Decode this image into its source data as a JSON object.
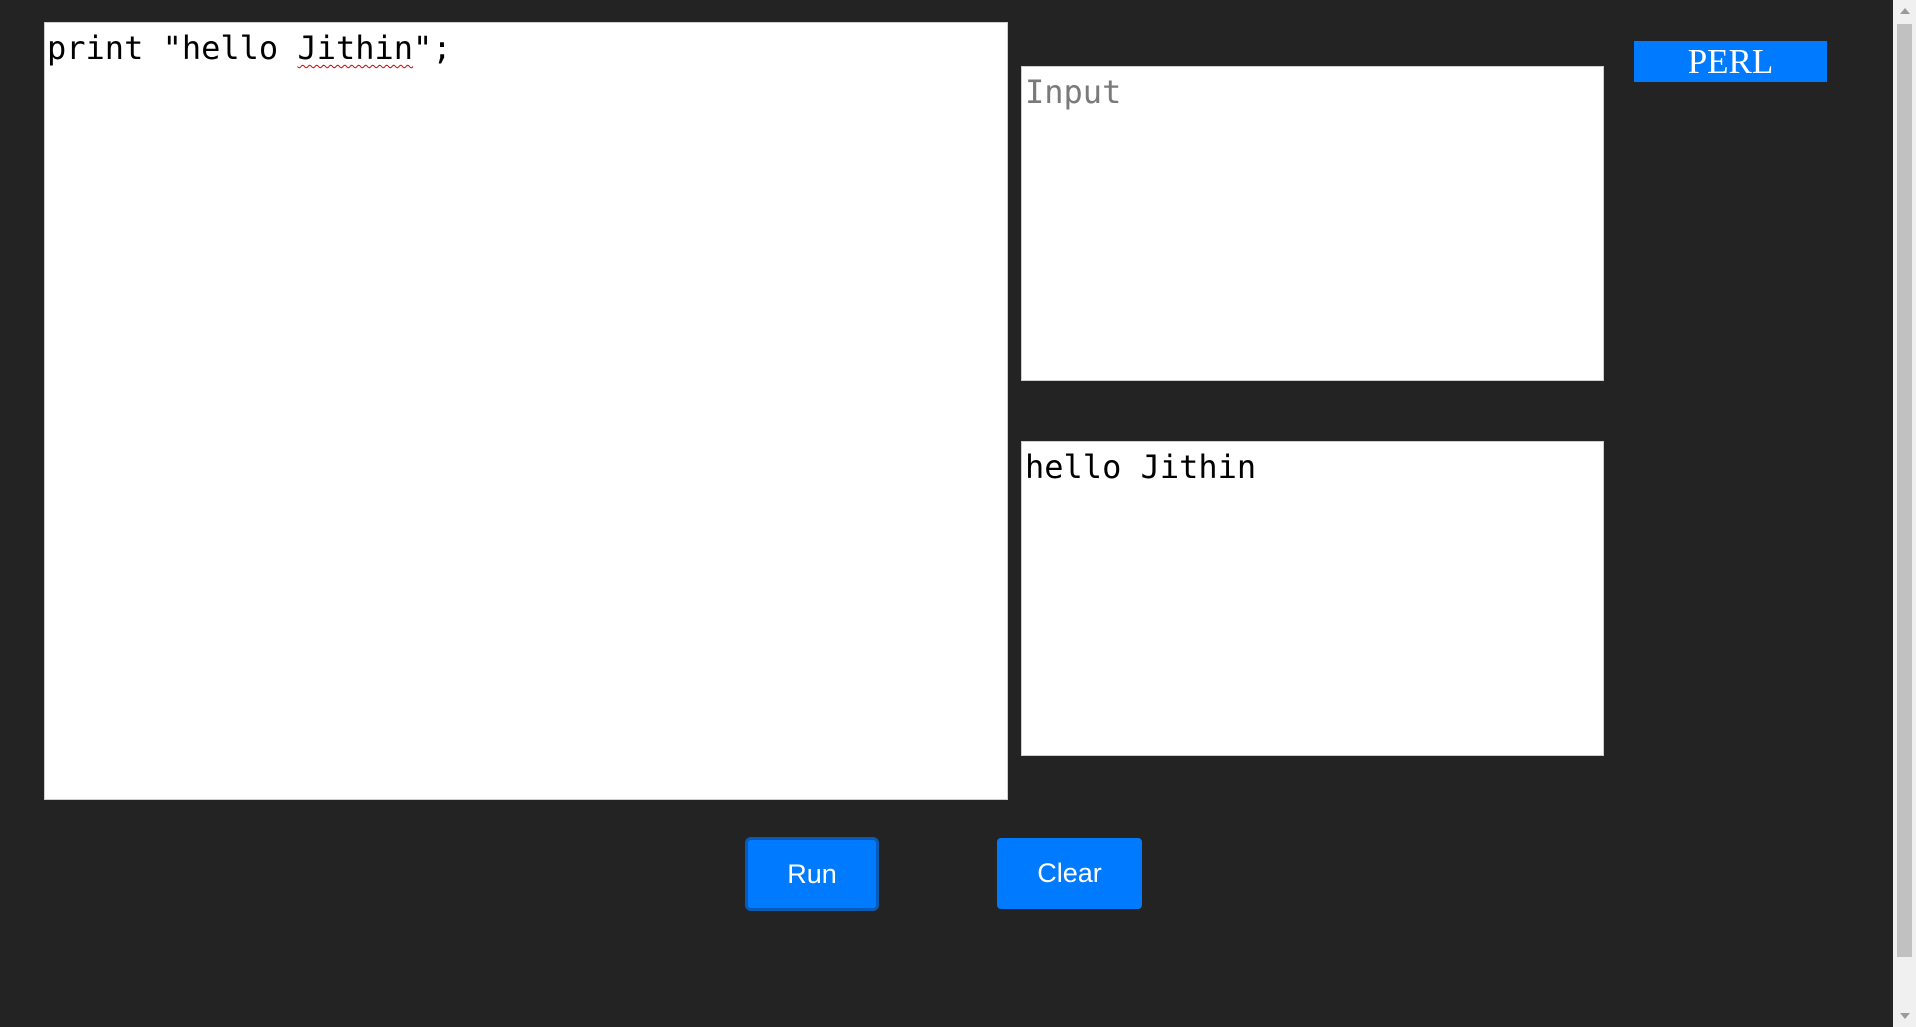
{
  "editor": {
    "code_prefix": "print \"hello ",
    "code_word": "Jithin",
    "code_suffix": "\";"
  },
  "input": {
    "placeholder": "Input"
  },
  "output": {
    "text": "hello Jithin"
  },
  "language": {
    "label": "PERL"
  },
  "buttons": {
    "run_label": "Run",
    "clear_label": "Clear"
  },
  "colors": {
    "background": "#232323",
    "accent": "#007bff"
  }
}
